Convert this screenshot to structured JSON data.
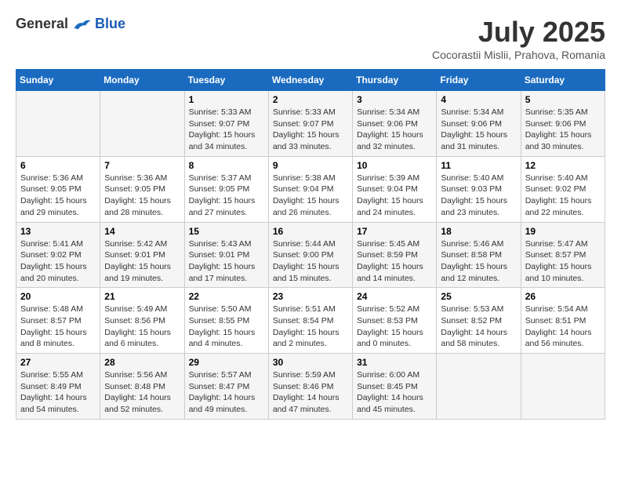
{
  "header": {
    "logo_general": "General",
    "logo_blue": "Blue",
    "title": "July 2025",
    "location": "Cocorastii Mislii, Prahova, Romania"
  },
  "weekdays": [
    "Sunday",
    "Monday",
    "Tuesday",
    "Wednesday",
    "Thursday",
    "Friday",
    "Saturday"
  ],
  "weeks": [
    [
      {
        "day": "",
        "info": ""
      },
      {
        "day": "",
        "info": ""
      },
      {
        "day": "1",
        "info": "Sunrise: 5:33 AM\nSunset: 9:07 PM\nDaylight: 15 hours and 34 minutes."
      },
      {
        "day": "2",
        "info": "Sunrise: 5:33 AM\nSunset: 9:07 PM\nDaylight: 15 hours and 33 minutes."
      },
      {
        "day": "3",
        "info": "Sunrise: 5:34 AM\nSunset: 9:06 PM\nDaylight: 15 hours and 32 minutes."
      },
      {
        "day": "4",
        "info": "Sunrise: 5:34 AM\nSunset: 9:06 PM\nDaylight: 15 hours and 31 minutes."
      },
      {
        "day": "5",
        "info": "Sunrise: 5:35 AM\nSunset: 9:06 PM\nDaylight: 15 hours and 30 minutes."
      }
    ],
    [
      {
        "day": "6",
        "info": "Sunrise: 5:36 AM\nSunset: 9:05 PM\nDaylight: 15 hours and 29 minutes."
      },
      {
        "day": "7",
        "info": "Sunrise: 5:36 AM\nSunset: 9:05 PM\nDaylight: 15 hours and 28 minutes."
      },
      {
        "day": "8",
        "info": "Sunrise: 5:37 AM\nSunset: 9:05 PM\nDaylight: 15 hours and 27 minutes."
      },
      {
        "day": "9",
        "info": "Sunrise: 5:38 AM\nSunset: 9:04 PM\nDaylight: 15 hours and 26 minutes."
      },
      {
        "day": "10",
        "info": "Sunrise: 5:39 AM\nSunset: 9:04 PM\nDaylight: 15 hours and 24 minutes."
      },
      {
        "day": "11",
        "info": "Sunrise: 5:40 AM\nSunset: 9:03 PM\nDaylight: 15 hours and 23 minutes."
      },
      {
        "day": "12",
        "info": "Sunrise: 5:40 AM\nSunset: 9:02 PM\nDaylight: 15 hours and 22 minutes."
      }
    ],
    [
      {
        "day": "13",
        "info": "Sunrise: 5:41 AM\nSunset: 9:02 PM\nDaylight: 15 hours and 20 minutes."
      },
      {
        "day": "14",
        "info": "Sunrise: 5:42 AM\nSunset: 9:01 PM\nDaylight: 15 hours and 19 minutes."
      },
      {
        "day": "15",
        "info": "Sunrise: 5:43 AM\nSunset: 9:01 PM\nDaylight: 15 hours and 17 minutes."
      },
      {
        "day": "16",
        "info": "Sunrise: 5:44 AM\nSunset: 9:00 PM\nDaylight: 15 hours and 15 minutes."
      },
      {
        "day": "17",
        "info": "Sunrise: 5:45 AM\nSunset: 8:59 PM\nDaylight: 15 hours and 14 minutes."
      },
      {
        "day": "18",
        "info": "Sunrise: 5:46 AM\nSunset: 8:58 PM\nDaylight: 15 hours and 12 minutes."
      },
      {
        "day": "19",
        "info": "Sunrise: 5:47 AM\nSunset: 8:57 PM\nDaylight: 15 hours and 10 minutes."
      }
    ],
    [
      {
        "day": "20",
        "info": "Sunrise: 5:48 AM\nSunset: 8:57 PM\nDaylight: 15 hours and 8 minutes."
      },
      {
        "day": "21",
        "info": "Sunrise: 5:49 AM\nSunset: 8:56 PM\nDaylight: 15 hours and 6 minutes."
      },
      {
        "day": "22",
        "info": "Sunrise: 5:50 AM\nSunset: 8:55 PM\nDaylight: 15 hours and 4 minutes."
      },
      {
        "day": "23",
        "info": "Sunrise: 5:51 AM\nSunset: 8:54 PM\nDaylight: 15 hours and 2 minutes."
      },
      {
        "day": "24",
        "info": "Sunrise: 5:52 AM\nSunset: 8:53 PM\nDaylight: 15 hours and 0 minutes."
      },
      {
        "day": "25",
        "info": "Sunrise: 5:53 AM\nSunset: 8:52 PM\nDaylight: 14 hours and 58 minutes."
      },
      {
        "day": "26",
        "info": "Sunrise: 5:54 AM\nSunset: 8:51 PM\nDaylight: 14 hours and 56 minutes."
      }
    ],
    [
      {
        "day": "27",
        "info": "Sunrise: 5:55 AM\nSunset: 8:49 PM\nDaylight: 14 hours and 54 minutes."
      },
      {
        "day": "28",
        "info": "Sunrise: 5:56 AM\nSunset: 8:48 PM\nDaylight: 14 hours and 52 minutes."
      },
      {
        "day": "29",
        "info": "Sunrise: 5:57 AM\nSunset: 8:47 PM\nDaylight: 14 hours and 49 minutes."
      },
      {
        "day": "30",
        "info": "Sunrise: 5:59 AM\nSunset: 8:46 PM\nDaylight: 14 hours and 47 minutes."
      },
      {
        "day": "31",
        "info": "Sunrise: 6:00 AM\nSunset: 8:45 PM\nDaylight: 14 hours and 45 minutes."
      },
      {
        "day": "",
        "info": ""
      },
      {
        "day": "",
        "info": ""
      }
    ]
  ]
}
